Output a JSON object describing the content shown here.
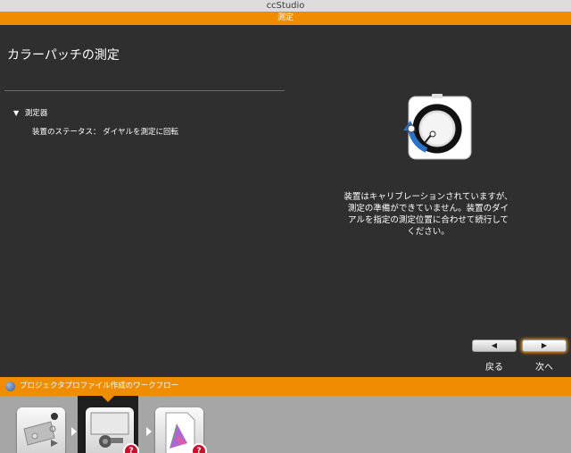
{
  "window": {
    "title": "ccStudio"
  },
  "header": {
    "section": "測定"
  },
  "main": {
    "title": "カラーパッチの測定",
    "section_label": "測定器",
    "status_label": "装置のステータス：",
    "status_value": "ダイヤルを測定に回転"
  },
  "device_icon": "colorimeter-dial-icon",
  "message": {
    "lines": [
      "装置はキャリブレーションされていますが、",
      "測定の準備ができていません。装置のダイ",
      "アルを指定の測定位置に合わせて続行して",
      "ください。"
    ]
  },
  "nav": {
    "back_label": "戻る",
    "next_label": "次へ"
  },
  "workflow": {
    "title": "プロジェクタプロファイル作成のワークフロー",
    "steps": [
      {
        "icon": "projector-settings-icon",
        "active": false
      },
      {
        "icon": "projector-measure-icon",
        "active": true,
        "badge": "?"
      },
      {
        "icon": "profile-gamut-icon",
        "active": false,
        "badge": "?"
      }
    ]
  },
  "colors": {
    "accent": "#f08c00",
    "background": "#2f2f2f",
    "badge": "#c8102e"
  }
}
